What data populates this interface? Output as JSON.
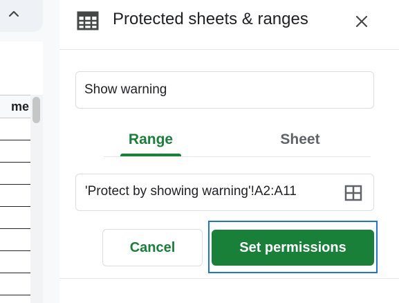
{
  "spreadsheet": {
    "column_header": "me",
    "visible_row_count": 8
  },
  "panel": {
    "title": "Protected sheets & ranges",
    "header_icon": "table-grid-icon",
    "close_icon": "close-icon",
    "description_value": "Show warning",
    "tabs": [
      {
        "label": "Range",
        "active": true
      },
      {
        "label": "Sheet",
        "active": false
      }
    ],
    "range_value": "'Protect by showing warning'!A2:A11",
    "range_select_icon": "select-range-icon",
    "cancel_label": "Cancel",
    "set_permissions_label": "Set permissions"
  },
  "colors": {
    "accent": "#188038",
    "focus": "#1a73e8",
    "text": "#202124",
    "muted": "#5f6368"
  }
}
